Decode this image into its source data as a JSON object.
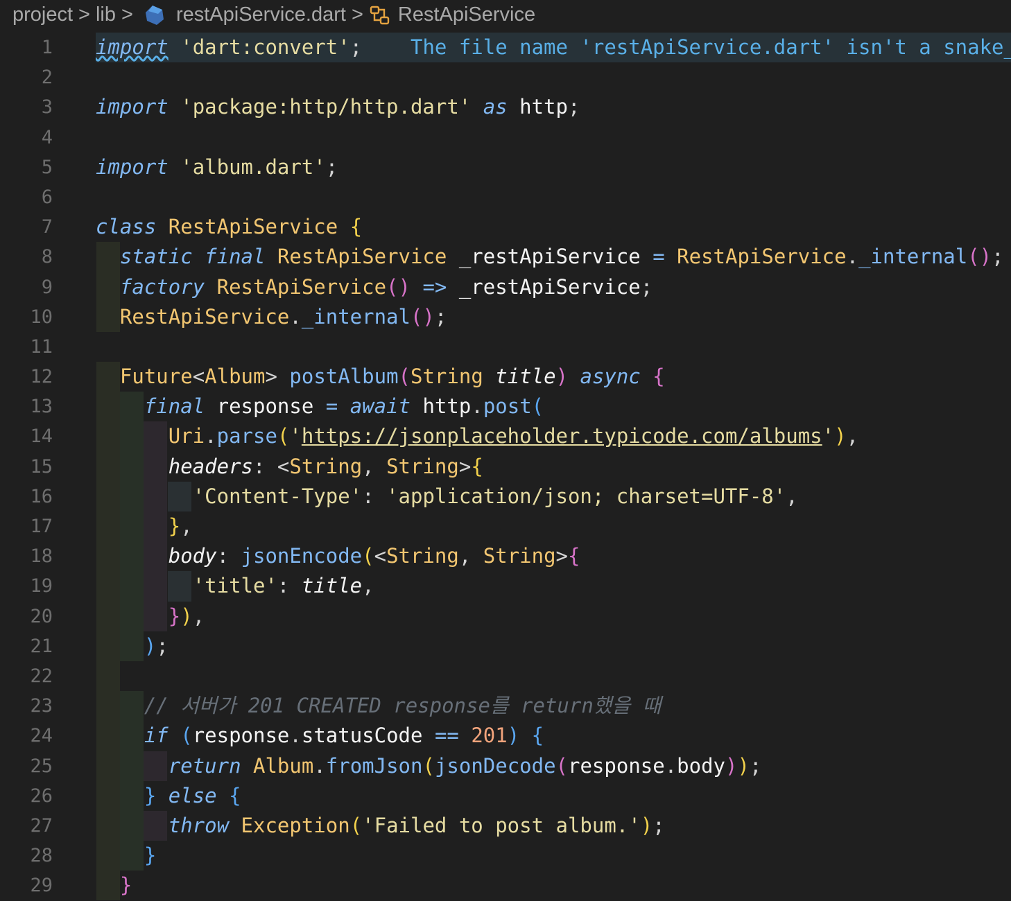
{
  "breadcrumb": {
    "project": "project",
    "folder": "lib",
    "file": "restApiService.dart",
    "symbol": "RestApiService",
    "separator": ">"
  },
  "diagnostic": "The file name 'restApiService.dart' isn't a snake_",
  "colors": {
    "background": "#1f1f1f",
    "keyword": "#82b8f2",
    "string": "#e6dca2",
    "class": "#f2c671",
    "comment": "#676f78",
    "number": "#f2a47c",
    "bracket_yellow": "#f2d14c",
    "bracket_pink": "#d773c8",
    "bracket_blue": "#5aa6f0",
    "diagnostic": "#5ab0e8"
  },
  "icons": {
    "file": "dart-file-icon",
    "symbol": "class-symbol-icon",
    "chevron": "chevron-right-icon"
  },
  "line_numbers": [
    "1",
    "2",
    "3",
    "4",
    "5",
    "6",
    "7",
    "8",
    "9",
    "10",
    "11",
    "12",
    "13",
    "14",
    "15",
    "16",
    "17",
    "18",
    "19",
    "20",
    "21",
    "22",
    "23",
    "24",
    "25",
    "26",
    "27",
    "28",
    "29"
  ],
  "code": {
    "l1_import": "import",
    "l1_str": "'dart:convert'",
    "l3_import": "import",
    "l3_str": "'package:http/http.dart'",
    "l3_as": "as",
    "l3_alias": "http",
    "l5_import": "import",
    "l5_str": "'album.dart'",
    "l7_class": "class",
    "l7_name": "RestApiService",
    "l8_static": "static",
    "l8_final": "final",
    "l8_type": "RestApiService",
    "l8_var": "_restApiService",
    "l8_ctor_cls": "RestApiService",
    "l8_ctor_fn": "_internal",
    "l9_factory": "factory",
    "l9_name": "RestApiService",
    "l9_arrow": "=>",
    "l9_var": "_restApiService",
    "l10_cls": "RestApiService",
    "l10_fn": "_internal",
    "l12_future": "Future",
    "l12_album": "Album",
    "l12_fn": "postAlbum",
    "l12_type": "String",
    "l12_param": "title",
    "l12_async": "async",
    "l13_final": "final",
    "l13_var": "response",
    "l13_await": "await",
    "l13_http": "http",
    "l13_post": "post",
    "l14_uri": "Uri",
    "l14_parse": "parse",
    "l14_url": "https://jsonplaceholder.typicode.com/albums",
    "l15_headers": "headers",
    "l15_t1": "String",
    "l15_t2": "String",
    "l16_key": "'Content-Type'",
    "l16_val": "'application/json; charset=UTF-8'",
    "l18_body": "body",
    "l18_fn": "jsonEncode",
    "l18_t1": "String",
    "l18_t2": "String",
    "l19_key": "'title'",
    "l19_val": "title",
    "l23_comment": "// 서버가 201 CREATED response를 return했을 때",
    "l24_if": "if",
    "l24_var": "response",
    "l24_prop": "statusCode",
    "l24_num": "201",
    "l25_return": "return",
    "l25_cls": "Album",
    "l25_fn": "fromJson",
    "l25_fn2": "jsonDecode",
    "l25_var": "response",
    "l25_prop": "body",
    "l26_else": "else",
    "l27_throw": "throw",
    "l27_cls": "Exception",
    "l27_str": "'Failed to post album.'"
  }
}
